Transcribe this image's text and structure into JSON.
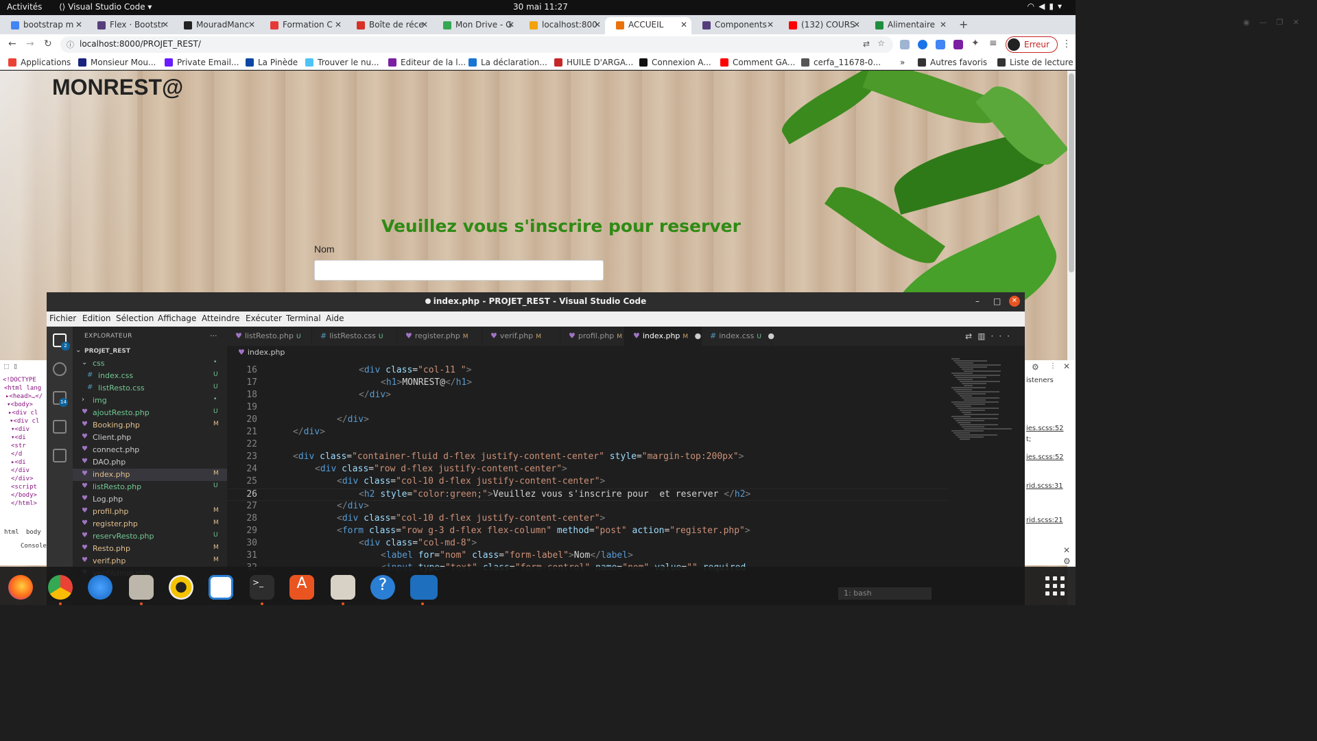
{
  "system": {
    "activities": "Activités",
    "app_name": "Visual Studio Code",
    "clock": "30 mai  11:27"
  },
  "browser": {
    "tabs": [
      {
        "label": "bootstrap m",
        "color": "#4285f4"
      },
      {
        "label": "Flex · Bootstr",
        "color": "#563d7c"
      },
      {
        "label": "MouradManc",
        "color": "#222222"
      },
      {
        "label": "Formation C",
        "color": "#e53935"
      },
      {
        "label": "Boîte de réce",
        "color": "#d93025"
      },
      {
        "label": "Mon Drive - G",
        "color": "#34a853"
      },
      {
        "label": "localhost:800",
        "color": "#f0a30a"
      },
      {
        "label": "ACCUEIL",
        "color": "#e8710a"
      },
      {
        "label": "Components",
        "color": "#563d7c"
      },
      {
        "label": "(132) COURS",
        "color": "#ff0000"
      },
      {
        "label": "Alimentaire",
        "color": "#1e8e3e"
      }
    ],
    "url": "localhost:8000/PROJET_REST/",
    "error_button": "Erreur",
    "bookmarks": [
      {
        "label": "Applications",
        "color": "#ea4335"
      },
      {
        "label": "Monsieur Mou...",
        "color": "#1a237e"
      },
      {
        "label": "Private Email...",
        "color": "#6a1bff"
      },
      {
        "label": "La Pinède",
        "color": "#0d47a1"
      },
      {
        "label": "Trouver le nu...",
        "color": "#4fc3f7"
      },
      {
        "label": "Editeur de la l...",
        "color": "#7b1fa2"
      },
      {
        "label": "La déclaration...",
        "color": "#1976d2"
      },
      {
        "label": "HUILE D'ARGA...",
        "color": "#c62828"
      },
      {
        "label": "Connexion A...",
        "color": "#111111"
      },
      {
        "label": "Comment GA...",
        "color": "#ff0000"
      },
      {
        "label": "cerfa_11678-0...",
        "color": "#555555"
      },
      {
        "label": "Autres favoris",
        "color": "#333333"
      },
      {
        "label": "Liste de lecture",
        "color": "#333333"
      }
    ]
  },
  "webpage": {
    "brand": "MONREST@",
    "headline": "Veuillez vous s'inscrire pour reserver",
    "nom_label": "Nom",
    "headline_color": "#2e8b14"
  },
  "devtools": {
    "left_lines": [
      "<!DOCTYPE",
      "<html lang",
      "▸<head>…</",
      "▾<body>",
      "▸<div cl",
      "▾<div cl",
      "▾<div",
      "▾<di",
      "<str",
      "</d",
      "▸<di",
      "</div",
      "</div>",
      "<script",
      "</body>",
      "</html>"
    ],
    "left_bottom": [
      "html",
      "body",
      "Console"
    ],
    "right_lines": [
      "isteners",
      "ies.scss:52",
      "t;",
      "ies.scss:52",
      "rid.scss:31",
      "rid.scss:21"
    ]
  },
  "vscode": {
    "title": "index.php - PROJET_REST - Visual Studio Code",
    "menu": [
      "Fichier",
      "Edition",
      "Sélection",
      "Affichage",
      "Atteindre",
      "Exécuter",
      "Terminal",
      "Aide"
    ],
    "explorer_title": "EXPLORATEUR",
    "project": "PROJET_REST",
    "badges": {
      "explorer": "2",
      "scm": "14"
    },
    "files": [
      {
        "name": "css",
        "kind": "folder-open",
        "status": "•",
        "indent": 1
      },
      {
        "name": "index.css",
        "kind": "css",
        "status": "U",
        "indent": 2
      },
      {
        "name": "listResto.css",
        "kind": "css",
        "status": "U",
        "indent": 2
      },
      {
        "name": "img",
        "kind": "folder",
        "status": "•",
        "indent": 1
      },
      {
        "name": "ajoutResto.php",
        "kind": "php",
        "status": "U",
        "indent": 1
      },
      {
        "name": "Booking.php",
        "kind": "php",
        "status": "M",
        "indent": 1
      },
      {
        "name": "Client.php",
        "kind": "php",
        "status": "",
        "indent": 1
      },
      {
        "name": "connect.php",
        "kind": "php",
        "status": "",
        "indent": 1
      },
      {
        "name": "DAO.php",
        "kind": "php",
        "status": "",
        "indent": 1
      },
      {
        "name": "index.php",
        "kind": "php",
        "status": "M",
        "indent": 1
      },
      {
        "name": "listResto.php",
        "kind": "php",
        "status": "U",
        "indent": 1
      },
      {
        "name": "Log.php",
        "kind": "php",
        "status": "",
        "indent": 1
      },
      {
        "name": "profil.php",
        "kind": "php",
        "status": "M",
        "indent": 1
      },
      {
        "name": "register.php",
        "kind": "php",
        "status": "M",
        "indent": 1
      },
      {
        "name": "reservResto.php",
        "kind": "php",
        "status": "U",
        "indent": 1
      },
      {
        "name": "Resto.php",
        "kind": "php",
        "status": "M",
        "indent": 1
      },
      {
        "name": "verif.php",
        "kind": "php",
        "status": "M",
        "indent": 1
      },
      {
        "name": "verifAdmin.php",
        "kind": "php",
        "status": "",
        "indent": 1
      }
    ],
    "tabs": [
      {
        "label": "listResto.php",
        "kind": "php",
        "status": "U"
      },
      {
        "label": "listResto.css",
        "kind": "css",
        "status": "U"
      },
      {
        "label": "register.php",
        "kind": "php",
        "status": "M"
      },
      {
        "label": "verif.php",
        "kind": "php",
        "status": "M"
      },
      {
        "label": "profil.php",
        "kind": "php",
        "status": "M"
      },
      {
        "label": "index.php",
        "kind": "php",
        "status": "M"
      },
      {
        "label": "index.css",
        "kind": "css",
        "status": "U"
      }
    ],
    "breadcrumb": "index.php",
    "current_line": "26",
    "terminal_select": "1: bash",
    "code_lines": [
      {
        "n": "16",
        "indent": 3,
        "html": "<span class=\"tg\">&lt;</span><span class=\"tn\">div</span> <span class=\"at\">class</span><span class=\"tx\">=</span><span class=\"sv\">\"col-11 \"</span><span class=\"tg\">&gt;</span>"
      },
      {
        "n": "17",
        "indent": 4,
        "html": "<span class=\"tg\">&lt;</span><span class=\"tn\">h1</span><span class=\"tg\">&gt;</span><span class=\"tx\">MONREST@</span><span class=\"tg\">&lt;/</span><span class=\"tn\">h1</span><span class=\"tg\">&gt;</span>"
      },
      {
        "n": "18",
        "indent": 3,
        "html": "<span class=\"tg\">&lt;/</span><span class=\"tn\">div</span><span class=\"tg\">&gt;</span>"
      },
      {
        "n": "19",
        "indent": 0,
        "html": ""
      },
      {
        "n": "20",
        "indent": 2,
        "html": "<span class=\"tg\">&lt;/</span><span class=\"tn\">div</span><span class=\"tg\">&gt;</span>"
      },
      {
        "n": "21",
        "indent": 0,
        "html": "<span class=\"tg\">&lt;/</span><span class=\"tn\">div</span><span class=\"tg\">&gt;</span>"
      },
      {
        "n": "22",
        "indent": 0,
        "html": ""
      },
      {
        "n": "23",
        "indent": 0,
        "html": "<span class=\"tg\">&lt;</span><span class=\"tn\">div</span> <span class=\"at\">class</span><span class=\"tx\">=</span><span class=\"sv\">\"container-fluid d-flex justify-content-center\"</span> <span class=\"at\">style</span><span class=\"tx\">=</span><span class=\"sv\">\"margin-top:200px\"</span><span class=\"tg\">&gt;</span>"
      },
      {
        "n": "24",
        "indent": 1,
        "html": "<span class=\"tg\">&lt;</span><span class=\"tn\">div</span> <span class=\"at\">class</span><span class=\"tx\">=</span><span class=\"sv\">\"row d-flex justify-content-center\"</span><span class=\"tg\">&gt;</span>"
      },
      {
        "n": "25",
        "indent": 2,
        "html": "<span class=\"tg\">&lt;</span><span class=\"tn\">div</span> <span class=\"at\">class</span><span class=\"tx\">=</span><span class=\"sv\">\"col-10 d-flex justify-content-center\"</span><span class=\"tg\">&gt;</span>"
      },
      {
        "n": "26",
        "indent": 3,
        "html": "<span class=\"tg\">&lt;</span><span class=\"tn\">h2</span> <span class=\"at\">style</span><span class=\"tx\">=</span><span class=\"sv\">\"color:green;\"</span><span class=\"tg\">&gt;</span><span class=\"tx\">Veuillez vous s'inscrire pour  et reserver </span><span class=\"tg\">&lt;/</span><span class=\"tn\">h2</span><span class=\"tg\">&gt;</span>"
      },
      {
        "n": "27",
        "indent": 2,
        "html": "<span class=\"tg\">&lt;/</span><span class=\"tn\">div</span><span class=\"tg\">&gt;</span>"
      },
      {
        "n": "28",
        "indent": 2,
        "html": "<span class=\"tg\">&lt;</span><span class=\"tn\">div</span> <span class=\"at\">class</span><span class=\"tx\">=</span><span class=\"sv\">\"col-10 d-flex justify-content-center\"</span><span class=\"tg\">&gt;</span>"
      },
      {
        "n": "29",
        "indent": 2,
        "html": "<span class=\"tg\">&lt;</span><span class=\"tn\">form</span> <span class=\"at\">class</span><span class=\"tx\">=</span><span class=\"sv\">\"row g-3 d-flex flex-column\"</span> <span class=\"at\">method</span><span class=\"tx\">=</span><span class=\"sv\">\"post\"</span> <span class=\"at\">action</span><span class=\"tx\">=</span><span class=\"sv\">\"register.php\"</span><span class=\"tg\">&gt;</span>"
      },
      {
        "n": "30",
        "indent": 3,
        "html": "<span class=\"tg\">&lt;</span><span class=\"tn\">div</span> <span class=\"at\">class</span><span class=\"tx\">=</span><span class=\"sv\">\"col-md-8\"</span><span class=\"tg\">&gt;</span>"
      },
      {
        "n": "31",
        "indent": 4,
        "html": "<span class=\"tg\">&lt;</span><span class=\"tn\">label</span> <span class=\"at\">for</span><span class=\"tx\">=</span><span class=\"sv\">\"nom\"</span> <span class=\"at\">class</span><span class=\"tx\">=</span><span class=\"sv\">\"form-label\"</span><span class=\"tg\">&gt;</span><span class=\"tx\">Nom</span><span class=\"tg\">&lt;/</span><span class=\"tn\">label</span><span class=\"tg\">&gt;</span>"
      },
      {
        "n": "32",
        "indent": 4,
        "html": "<span class=\"tg\">&lt;</span><span class=\"tn\">input</span> <span class=\"at\">type</span><span class=\"tx\">=</span><span class=\"sv\">\"text\"</span> <span class=\"at\">class</span><span class=\"tx\">=</span><span class=\"sv\">\"form-control\"</span> <span class=\"at\">name</span><span class=\"tx\">=</span><span class=\"sv\">\"nom\"</span> <span class=\"at\">value</span><span class=\"tx\">=</span><span class=\"sv\">\"\"</span> <span class=\"at\">required</span>"
      }
    ]
  }
}
